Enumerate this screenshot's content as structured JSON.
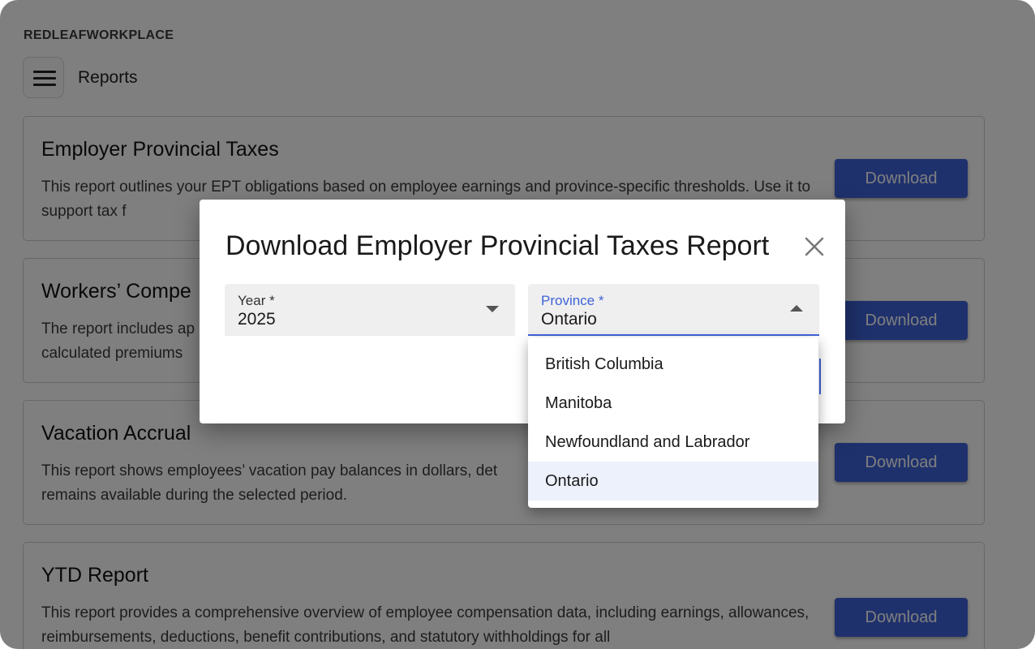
{
  "app": {
    "brand": "REDLEAFWORKPLACE",
    "page_title": "Reports"
  },
  "colors": {
    "accent": "#3f63d9",
    "overlay": "rgba(0,0,0,0.5)",
    "selected_option_bg": "#edf1fc"
  },
  "cards": [
    {
      "title": "Employer Provincial Taxes",
      "description": "This report outlines your EPT obligations based on employee earnings and province-specific thresholds. Use it to support tax f",
      "button_label": "Download"
    },
    {
      "title": "Workers’ Compe",
      "description": "The report includes ap calculated premiums",
      "button_label": "Download"
    },
    {
      "title": "Vacation Accrual",
      "description": "This report shows employees’ vacation pay balances in dollars, det remains available during the selected period.",
      "button_label": "Download"
    },
    {
      "title": "YTD Report",
      "description": "This report provides a comprehensive overview of employee compensation data, including earnings, allowances, reimbursements, deductions, benefit contributions, and statutory withholdings for all",
      "button_label": "Download"
    }
  ],
  "dialog": {
    "title": "Download Employer Provincial Taxes Report",
    "close_icon": "close-icon",
    "year_field": {
      "label": "Year *",
      "value": "2025"
    },
    "province_field": {
      "label": "Province *",
      "value": "Ontario",
      "expanded": true
    },
    "province_options": [
      "British Columbia",
      "Manitoba",
      "Newfoundland and Labrador",
      "Ontario"
    ],
    "selected_option": "Ontario"
  }
}
